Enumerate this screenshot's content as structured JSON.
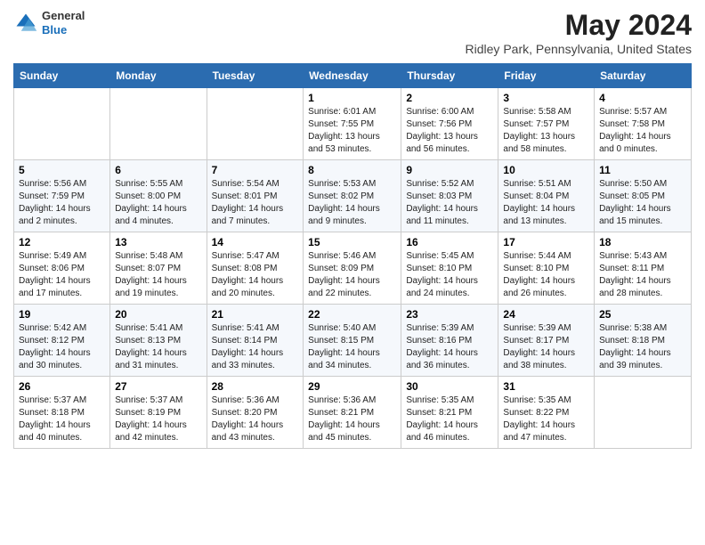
{
  "header": {
    "logo_line1": "General",
    "logo_line2": "Blue",
    "month": "May 2024",
    "location": "Ridley Park, Pennsylvania, United States"
  },
  "days_of_week": [
    "Sunday",
    "Monday",
    "Tuesday",
    "Wednesday",
    "Thursday",
    "Friday",
    "Saturday"
  ],
  "weeks": [
    [
      {
        "day": "",
        "info": ""
      },
      {
        "day": "",
        "info": ""
      },
      {
        "day": "",
        "info": ""
      },
      {
        "day": "1",
        "sunrise": "6:01 AM",
        "sunset": "7:55 PM",
        "daylight": "13 hours and 53 minutes."
      },
      {
        "day": "2",
        "sunrise": "6:00 AM",
        "sunset": "7:56 PM",
        "daylight": "13 hours and 56 minutes."
      },
      {
        "day": "3",
        "sunrise": "5:58 AM",
        "sunset": "7:57 PM",
        "daylight": "13 hours and 58 minutes."
      },
      {
        "day": "4",
        "sunrise": "5:57 AM",
        "sunset": "7:58 PM",
        "daylight": "14 hours and 0 minutes."
      }
    ],
    [
      {
        "day": "5",
        "sunrise": "5:56 AM",
        "sunset": "7:59 PM",
        "daylight": "14 hours and 2 minutes."
      },
      {
        "day": "6",
        "sunrise": "5:55 AM",
        "sunset": "8:00 PM",
        "daylight": "14 hours and 4 minutes."
      },
      {
        "day": "7",
        "sunrise": "5:54 AM",
        "sunset": "8:01 PM",
        "daylight": "14 hours and 7 minutes."
      },
      {
        "day": "8",
        "sunrise": "5:53 AM",
        "sunset": "8:02 PM",
        "daylight": "14 hours and 9 minutes."
      },
      {
        "day": "9",
        "sunrise": "5:52 AM",
        "sunset": "8:03 PM",
        "daylight": "14 hours and 11 minutes."
      },
      {
        "day": "10",
        "sunrise": "5:51 AM",
        "sunset": "8:04 PM",
        "daylight": "14 hours and 13 minutes."
      },
      {
        "day": "11",
        "sunrise": "5:50 AM",
        "sunset": "8:05 PM",
        "daylight": "14 hours and 15 minutes."
      }
    ],
    [
      {
        "day": "12",
        "sunrise": "5:49 AM",
        "sunset": "8:06 PM",
        "daylight": "14 hours and 17 minutes."
      },
      {
        "day": "13",
        "sunrise": "5:48 AM",
        "sunset": "8:07 PM",
        "daylight": "14 hours and 19 minutes."
      },
      {
        "day": "14",
        "sunrise": "5:47 AM",
        "sunset": "8:08 PM",
        "daylight": "14 hours and 20 minutes."
      },
      {
        "day": "15",
        "sunrise": "5:46 AM",
        "sunset": "8:09 PM",
        "daylight": "14 hours and 22 minutes."
      },
      {
        "day": "16",
        "sunrise": "5:45 AM",
        "sunset": "8:10 PM",
        "daylight": "14 hours and 24 minutes."
      },
      {
        "day": "17",
        "sunrise": "5:44 AM",
        "sunset": "8:10 PM",
        "daylight": "14 hours and 26 minutes."
      },
      {
        "day": "18",
        "sunrise": "5:43 AM",
        "sunset": "8:11 PM",
        "daylight": "14 hours and 28 minutes."
      }
    ],
    [
      {
        "day": "19",
        "sunrise": "5:42 AM",
        "sunset": "8:12 PM",
        "daylight": "14 hours and 30 minutes."
      },
      {
        "day": "20",
        "sunrise": "5:41 AM",
        "sunset": "8:13 PM",
        "daylight": "14 hours and 31 minutes."
      },
      {
        "day": "21",
        "sunrise": "5:41 AM",
        "sunset": "8:14 PM",
        "daylight": "14 hours and 33 minutes."
      },
      {
        "day": "22",
        "sunrise": "5:40 AM",
        "sunset": "8:15 PM",
        "daylight": "14 hours and 34 minutes."
      },
      {
        "day": "23",
        "sunrise": "5:39 AM",
        "sunset": "8:16 PM",
        "daylight": "14 hours and 36 minutes."
      },
      {
        "day": "24",
        "sunrise": "5:39 AM",
        "sunset": "8:17 PM",
        "daylight": "14 hours and 38 minutes."
      },
      {
        "day": "25",
        "sunrise": "5:38 AM",
        "sunset": "8:18 PM",
        "daylight": "14 hours and 39 minutes."
      }
    ],
    [
      {
        "day": "26",
        "sunrise": "5:37 AM",
        "sunset": "8:18 PM",
        "daylight": "14 hours and 40 minutes."
      },
      {
        "day": "27",
        "sunrise": "5:37 AM",
        "sunset": "8:19 PM",
        "daylight": "14 hours and 42 minutes."
      },
      {
        "day": "28",
        "sunrise": "5:36 AM",
        "sunset": "8:20 PM",
        "daylight": "14 hours and 43 minutes."
      },
      {
        "day": "29",
        "sunrise": "5:36 AM",
        "sunset": "8:21 PM",
        "daylight": "14 hours and 45 minutes."
      },
      {
        "day": "30",
        "sunrise": "5:35 AM",
        "sunset": "8:21 PM",
        "daylight": "14 hours and 46 minutes."
      },
      {
        "day": "31",
        "sunrise": "5:35 AM",
        "sunset": "8:22 PM",
        "daylight": "14 hours and 47 minutes."
      },
      {
        "day": "",
        "info": ""
      }
    ]
  ]
}
